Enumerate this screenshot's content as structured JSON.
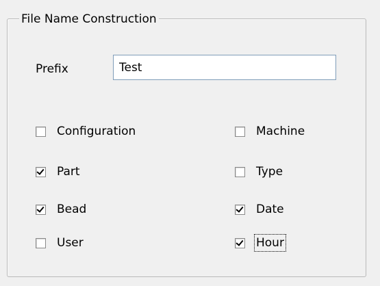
{
  "group": {
    "title": "File Name Construction"
  },
  "prefix": {
    "label": "Prefix",
    "value": "Test"
  },
  "options": {
    "configuration": {
      "label": "Configuration",
      "checked": false
    },
    "part": {
      "label": "Part",
      "checked": true
    },
    "bead": {
      "label": "Bead",
      "checked": true
    },
    "user": {
      "label": "User",
      "checked": false
    },
    "machine": {
      "label": "Machine",
      "checked": false
    },
    "type": {
      "label": "Type",
      "checked": false
    },
    "date": {
      "label": "Date",
      "checked": true
    },
    "hour": {
      "label": "Hour",
      "checked": true,
      "focused": true
    }
  }
}
